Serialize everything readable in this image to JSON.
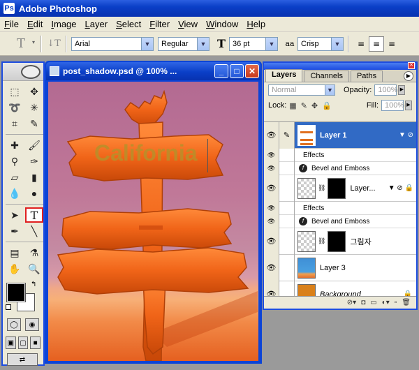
{
  "app": {
    "title": "Adobe Photoshop"
  },
  "menu": {
    "items": [
      {
        "label": "File",
        "key": "F",
        "rest": "ile"
      },
      {
        "label": "Edit",
        "key": "E",
        "rest": "dit"
      },
      {
        "label": "Image",
        "key": "I",
        "rest": "mage"
      },
      {
        "label": "Layer",
        "key": "L",
        "rest": "ayer"
      },
      {
        "label": "Select",
        "key": "S",
        "rest": "elect"
      },
      {
        "label": "Filter",
        "key": "F",
        "rest": "ilter"
      },
      {
        "label": "View",
        "key": "V",
        "rest": "iew"
      },
      {
        "label": "Window",
        "key": "W",
        "rest": "indow"
      },
      {
        "label": "Help",
        "key": "H",
        "rest": "elp"
      }
    ]
  },
  "options": {
    "font_family": "Arial",
    "font_style": "Regular",
    "font_size": "36 pt",
    "antialias_icon": "aa",
    "antialias": "Crisp"
  },
  "document": {
    "title": "post_shadow.psd @ 100% ...",
    "sign_text": "California"
  },
  "layers_panel": {
    "tabs": [
      "Layers",
      "Channels",
      "Paths"
    ],
    "active_tab": "Layers",
    "blend_mode": "Normal",
    "opacity_label": "Opacity:",
    "opacity": "100%",
    "lock_label": "Lock:",
    "fill_label": "Fill:",
    "fill": "100%",
    "layers": [
      {
        "name": "Layer 1",
        "selected": true,
        "effects_label": "Effects",
        "effect": "Bevel and Emboss"
      },
      {
        "name": "Layer...",
        "selected": false,
        "effects_label": "Effects",
        "effect": "Bevel and Emboss"
      },
      {
        "name": "그림자",
        "selected": false
      },
      {
        "name": "Layer 3",
        "selected": false
      },
      {
        "name": "Background",
        "selected": false
      }
    ]
  },
  "colors": {
    "titlebar": "#0a3fc7",
    "selection": "#316ac5",
    "sign_wood": "#f06418",
    "foreground": "#000000",
    "background": "#ffffff"
  }
}
